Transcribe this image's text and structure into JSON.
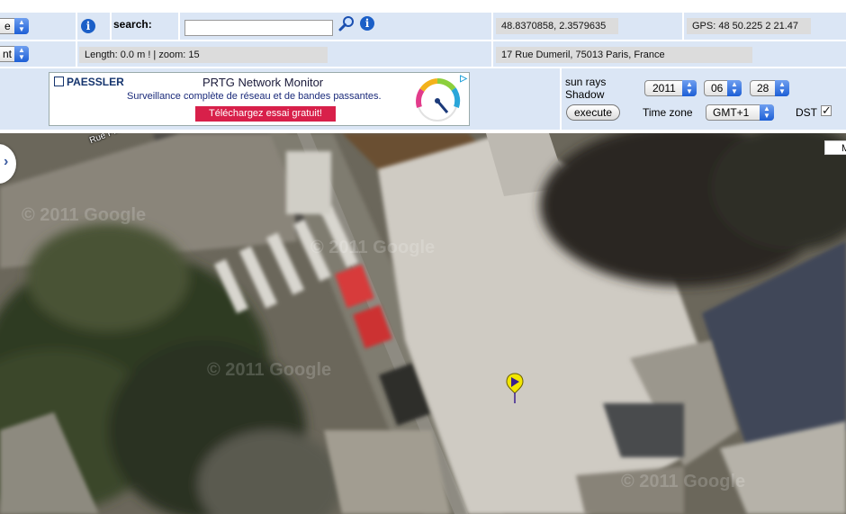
{
  "toolbar": {
    "row1": {
      "mode_select_value": "e",
      "search_label": "search:",
      "search_value": "",
      "coords_display": "48.8370858, 2.3579635",
      "gps_display": "GPS: 48 50.225  2 21.47"
    },
    "row2": {
      "unit_select_value": "nt",
      "length_zoom": "Length: 0.0 m !  | zoom: 15",
      "address": "17 Rue Dumeril, 75013 Paris, France"
    },
    "sun": {
      "line1": "sun rays",
      "line2": "Shadow",
      "execute_label": "execute",
      "year": "2011",
      "month": "06",
      "day": "28",
      "timezone_label": "Time zone",
      "timezone_value": "GMT+1",
      "dst_label": "DST",
      "dst_checked": true
    }
  },
  "ad": {
    "brand": "PAESSLER",
    "title": "PRTG Network Monitor",
    "subtitle": "Surveillance complète de réseau et de bandes passantes.",
    "cta": "Téléchargez essai gratuit!"
  },
  "map": {
    "street_label": "Rue Pirandello",
    "watermark": "© 2011 Google",
    "right_badge": "M",
    "colors": {
      "marker": "#f2e600",
      "marker_inner": "#3a1f8f"
    }
  }
}
